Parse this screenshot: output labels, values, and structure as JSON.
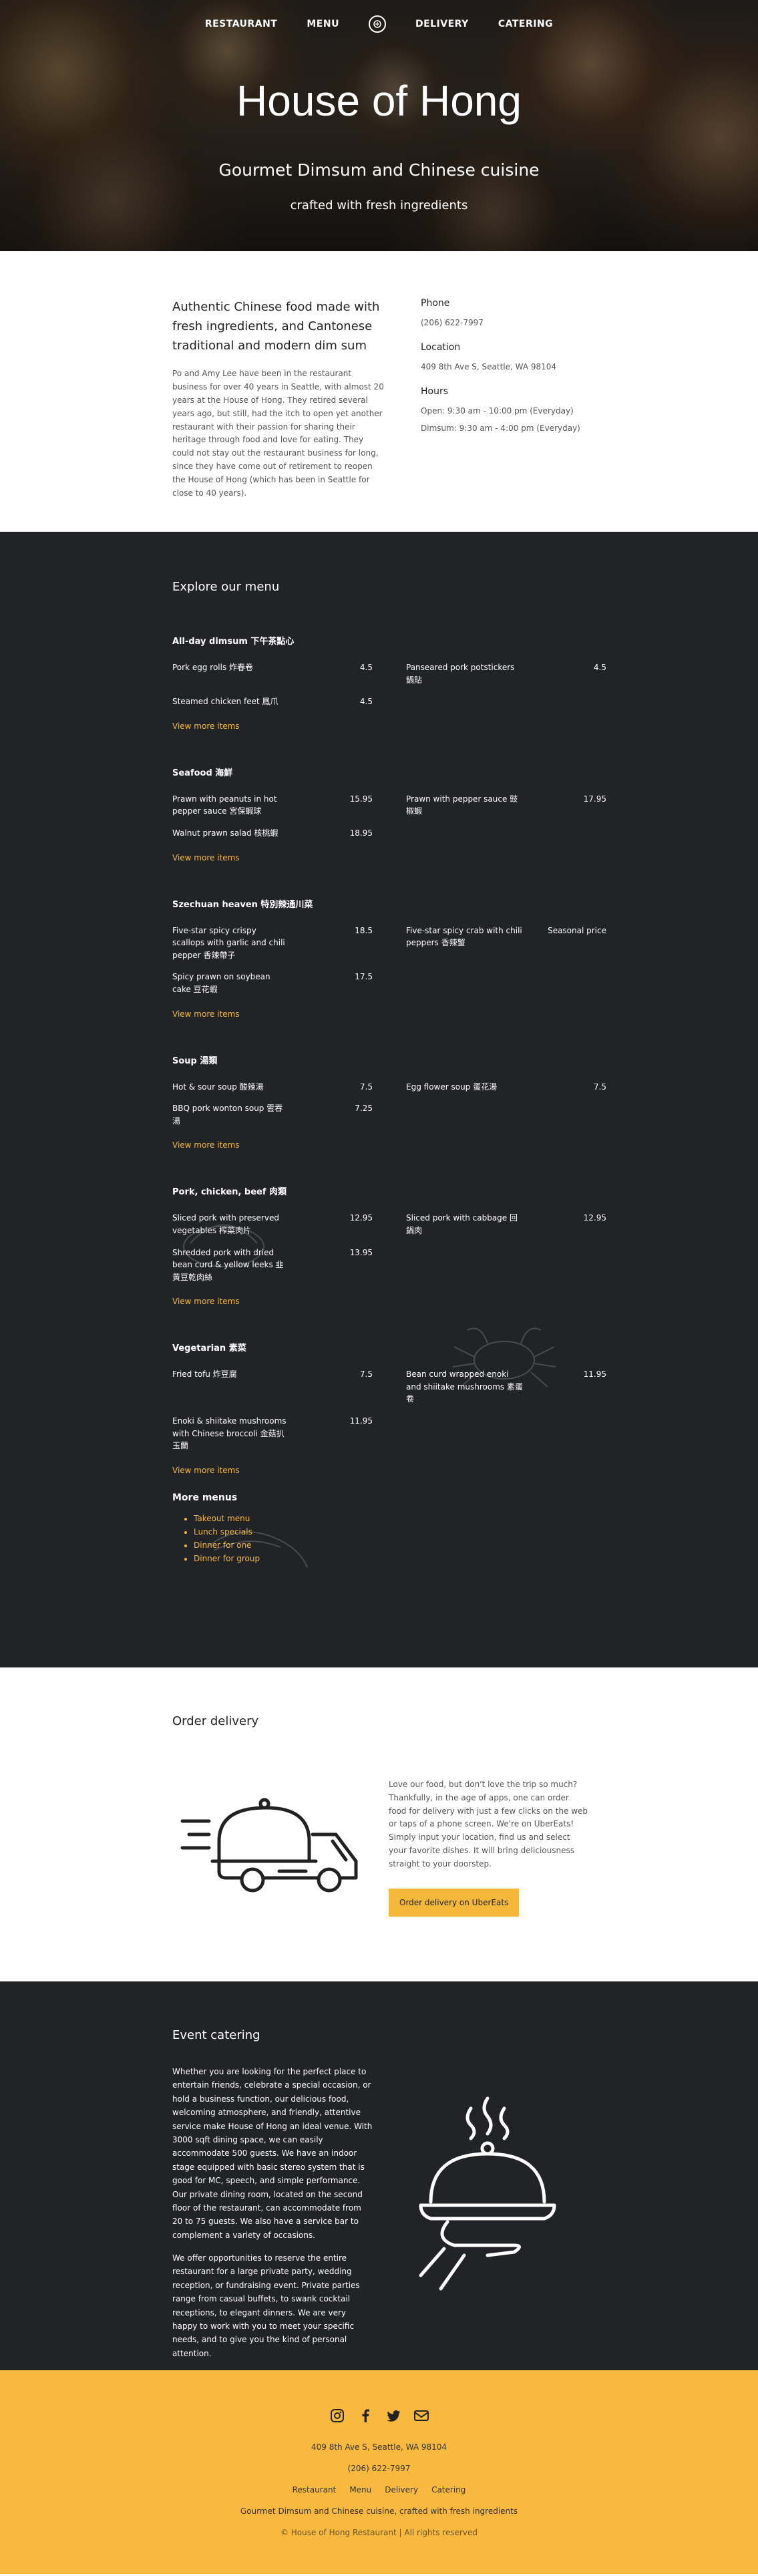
{
  "nav": {
    "restaurant": "RESTAURANT",
    "menu": "MENU",
    "delivery": "DELIVERY",
    "catering": "CATERING"
  },
  "hero": {
    "title": "House of Hong",
    "subtitle": "Gourmet Dimsum and Chinese cuisine",
    "tagline": "crafted with fresh ingredients"
  },
  "about": {
    "heading": "Authentic Chinese food made with fresh ingredients, and Cantonese traditional and modern dim sum",
    "body": "Po and Amy Lee have been in the restaurant business for over 40 years in Seattle, with almost 20 years at the House of Hong. They retired several years ago, but still, had the itch to open yet another restaurant with their passion for sharing their heritage through food and love for eating. They could not stay out the restaurant business for long, since they have come out of retirement to reopen the House of Hong (which has been in Seattle for close to 40 years).",
    "phone_label": "Phone",
    "phone": "(206) 622-7997",
    "location_label": "Location",
    "location": "409 8th Ave S, Seattle, WA 98104",
    "hours_label": "Hours",
    "hours_open": "Open: 9:30 am - 10:00 pm (Everyday)",
    "hours_dimsum": "Dimsum: 9:30 am - 4:00 pm (Everyday)"
  },
  "menu": {
    "title": "Explore our menu",
    "view_more": "View more items",
    "categories": [
      {
        "name": "All-day dimsum 下午茶點心",
        "items": [
          {
            "name": "Pork egg rolls 炸春卷",
            "price": "4.5"
          },
          {
            "name": "Panseared pork potstickers 鍋貼",
            "price": "4.5"
          },
          {
            "name": "Steamed chicken feet 鳳爪",
            "price": "4.5"
          }
        ]
      },
      {
        "name": "Seafood 海鮮",
        "items": [
          {
            "name": "Prawn with peanuts in hot pepper sauce 宮保蝦球",
            "price": "15.95"
          },
          {
            "name": "Prawn with pepper sauce 豉椒蝦",
            "price": "17.95"
          },
          {
            "name": "Walnut prawn salad 核桃蝦",
            "price": "18.95"
          }
        ]
      },
      {
        "name": "Szechuan heaven 特別辣通川菜",
        "items": [
          {
            "name": "Five-star spicy crispy scallops with garlic and chili pepper 香辣帶子",
            "price": "18.5"
          },
          {
            "name": "Five-star spicy crab with chili peppers 香辣蟹",
            "price": "Seasonal price"
          },
          {
            "name": "Spicy prawn on soybean cake 豆花蝦",
            "price": "17.5"
          }
        ]
      },
      {
        "name": "Soup 湯類",
        "items": [
          {
            "name": "Hot & sour soup 酸辣湯",
            "price": "7.5"
          },
          {
            "name": "Egg flower soup 蛋花湯",
            "price": "7.5"
          },
          {
            "name": "BBQ pork wonton soup 雲吞湯",
            "price": "7.25"
          }
        ]
      },
      {
        "name": "Pork, chicken, beef 肉類",
        "items": [
          {
            "name": "Sliced pork with preserved vegetables 榨菜肉片",
            "price": "12.95"
          },
          {
            "name": "Sliced pork with cabbage 回鍋肉",
            "price": "12.95"
          },
          {
            "name": "Shredded pork with dried bean curd & yellow leeks 韭黃豆乾肉絲",
            "price": "13.95"
          }
        ]
      },
      {
        "name": "Vegetarian 素菜",
        "items": [
          {
            "name": "Fried tofu 炸豆腐",
            "price": "7.5"
          },
          {
            "name": "Bean curd wrapped enoki and shiitake mushrooms 素蛋卷",
            "price": "11.95"
          },
          {
            "name": "Enoki & shiitake mushrooms with Chinese broccoli 金菇扒玉蘭",
            "price": "11.95"
          }
        ]
      }
    ],
    "more_menus_title": "More menus",
    "more_menus": [
      "Takeout menu",
      "Lunch specials",
      "Dinner for one",
      "Dinner for group"
    ]
  },
  "delivery": {
    "title": "Order delivery",
    "body": "Love our food, but don't love the trip so much? Thankfully, in the age of apps, one can order food for delivery with just a few clicks on the web or taps of a phone screen. We're on UberEats! Simply input your location, find us and select your favorite dishes. It will bring deliciousness straight to your doorstep.",
    "button": "Order delivery on UberEats"
  },
  "event": {
    "title": "Event catering",
    "p1": "Whether you are looking for the perfect place to entertain friends, celebrate a special occasion, or hold a business function, our delicious food, welcoming atmosphere, and friendly, attentive service make House of Hong an ideal venue. With 3000 sqft dining space, we can easily accommodate 500 guests. We have an indoor stage equipped with basic stereo system that is good for MC, speech, and simple performance. Our private dining room, located on the second floor of the restaurant, can accommodate from 20 to 75 guests. We also have a service bar to complement a variety of occasions.",
    "p2": "We offer opportunities to reserve the entire restaurant for a large private party, wedding reception, or fundraising event. Private parties range from casual buffets, to swank cocktail receptions, to elegant dinners. We are very happy to work with you to meet your specific needs, and to give you the kind of personal attention."
  },
  "footer": {
    "address": "409 8th Ave S, Seattle, WA 98104",
    "phone": "(206) 622-7997",
    "links": [
      "Restaurant",
      "Menu",
      "Delivery",
      "Catering"
    ],
    "tagline": "Gourmet Dimsum and Chinese cuisine, crafted with fresh ingredients",
    "copyright": "© House of Hong Restaurant | All rights reserved"
  },
  "colors": {
    "accent": "#f4b93a",
    "dark": "#222327",
    "footer": "#f9b93f"
  }
}
